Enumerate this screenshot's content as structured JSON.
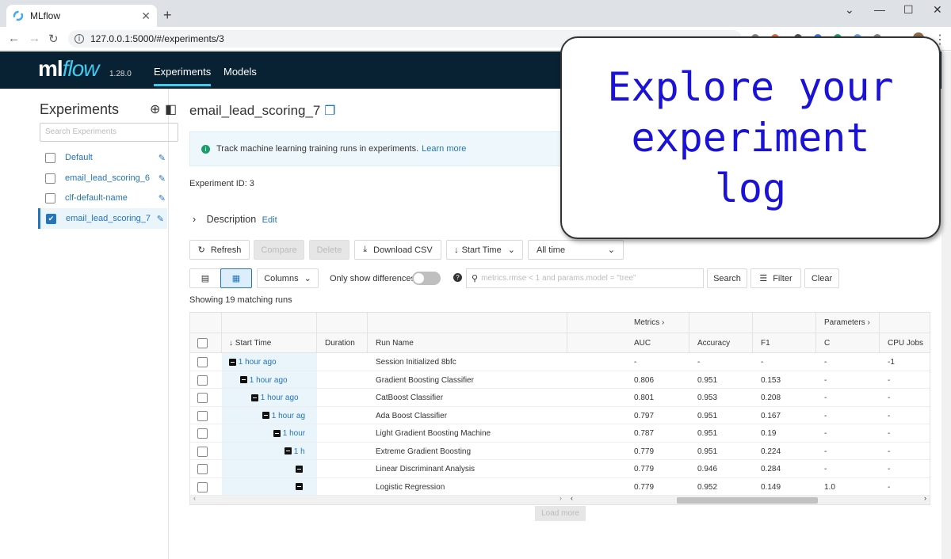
{
  "browser": {
    "tab_title": "MLflow",
    "tab_close": "✕",
    "new_tab": "+",
    "url": "127.0.0.1:5000/#/experiments/3"
  },
  "header": {
    "logo_ml": "ml",
    "logo_flow": "flow",
    "version": "1.28.0",
    "nav": [
      "Experiments",
      "Models"
    ]
  },
  "sidebar": {
    "title": "Experiments",
    "search_placeholder": "Search Experiments",
    "items": [
      {
        "label": "Default",
        "checked": false
      },
      {
        "label": "email_lead_scoring_6",
        "checked": false
      },
      {
        "label": "clf-default-name",
        "checked": false
      },
      {
        "label": "email_lead_scoring_7",
        "checked": true
      }
    ]
  },
  "main": {
    "title": "email_lead_scoring_7",
    "banner_text": "Track machine learning training runs in experiments.",
    "banner_link": "Learn more",
    "experiment_id": "Experiment ID:  3",
    "description": "Description",
    "edit": "Edit",
    "toolbar": {
      "refresh": "Refresh",
      "compare": "Compare",
      "delete": "Delete",
      "download": "Download CSV",
      "sort": "Start Time",
      "time_filter": "All time",
      "columns": "Columns",
      "only_diff": "Only show differences",
      "search_placeholder": "metrics.rmse < 1 and params.model = \"tree\"",
      "search": "Search",
      "filter": "Filter",
      "clear": "Clear"
    },
    "matching": "Showing 19 matching runs",
    "table": {
      "group_metrics": "Metrics",
      "group_params": "Parameters",
      "headers": [
        "Start Time",
        "Duration",
        "Run Name",
        "AUC",
        "Accuracy",
        "F1",
        "C",
        "CPU Jobs"
      ],
      "rows": [
        {
          "time": "1 hour ago",
          "name": "Session Initialized 8bfc",
          "auc": "-",
          "acc": "-",
          "f1": "-",
          "c": "-",
          "cpu": "-1"
        },
        {
          "time": "1 hour ago",
          "name": "Gradient Boosting Classifier",
          "auc": "0.806",
          "acc": "0.951",
          "f1": "0.153",
          "c": "-",
          "cpu": "-"
        },
        {
          "time": "1 hour ago",
          "name": "CatBoost Classifier",
          "auc": "0.801",
          "acc": "0.953",
          "f1": "0.208",
          "c": "-",
          "cpu": "-"
        },
        {
          "time": "1 hour ag",
          "name": "Ada Boost Classifier",
          "auc": "0.797",
          "acc": "0.951",
          "f1": "0.167",
          "c": "-",
          "cpu": "-"
        },
        {
          "time": "1 hour",
          "name": "Light Gradient Boosting Machine",
          "auc": "0.787",
          "acc": "0.951",
          "f1": "0.19",
          "c": "-",
          "cpu": "-"
        },
        {
          "time": "1 h",
          "name": "Extreme Gradient Boosting",
          "auc": "0.779",
          "acc": "0.951",
          "f1": "0.224",
          "c": "-",
          "cpu": "-"
        },
        {
          "time": "",
          "name": "Linear Discriminant Analysis",
          "auc": "0.779",
          "acc": "0.946",
          "f1": "0.284",
          "c": "-",
          "cpu": "-"
        },
        {
          "time": "",
          "name": "Logistic Regression",
          "auc": "0.779",
          "acc": "0.952",
          "f1": "0.149",
          "c": "1.0",
          "cpu": "-"
        }
      ]
    },
    "load_more": "Load more"
  },
  "callout": {
    "lines": [
      "Explore your",
      "experiment",
      "log"
    ],
    "color": "#1a12d6"
  }
}
